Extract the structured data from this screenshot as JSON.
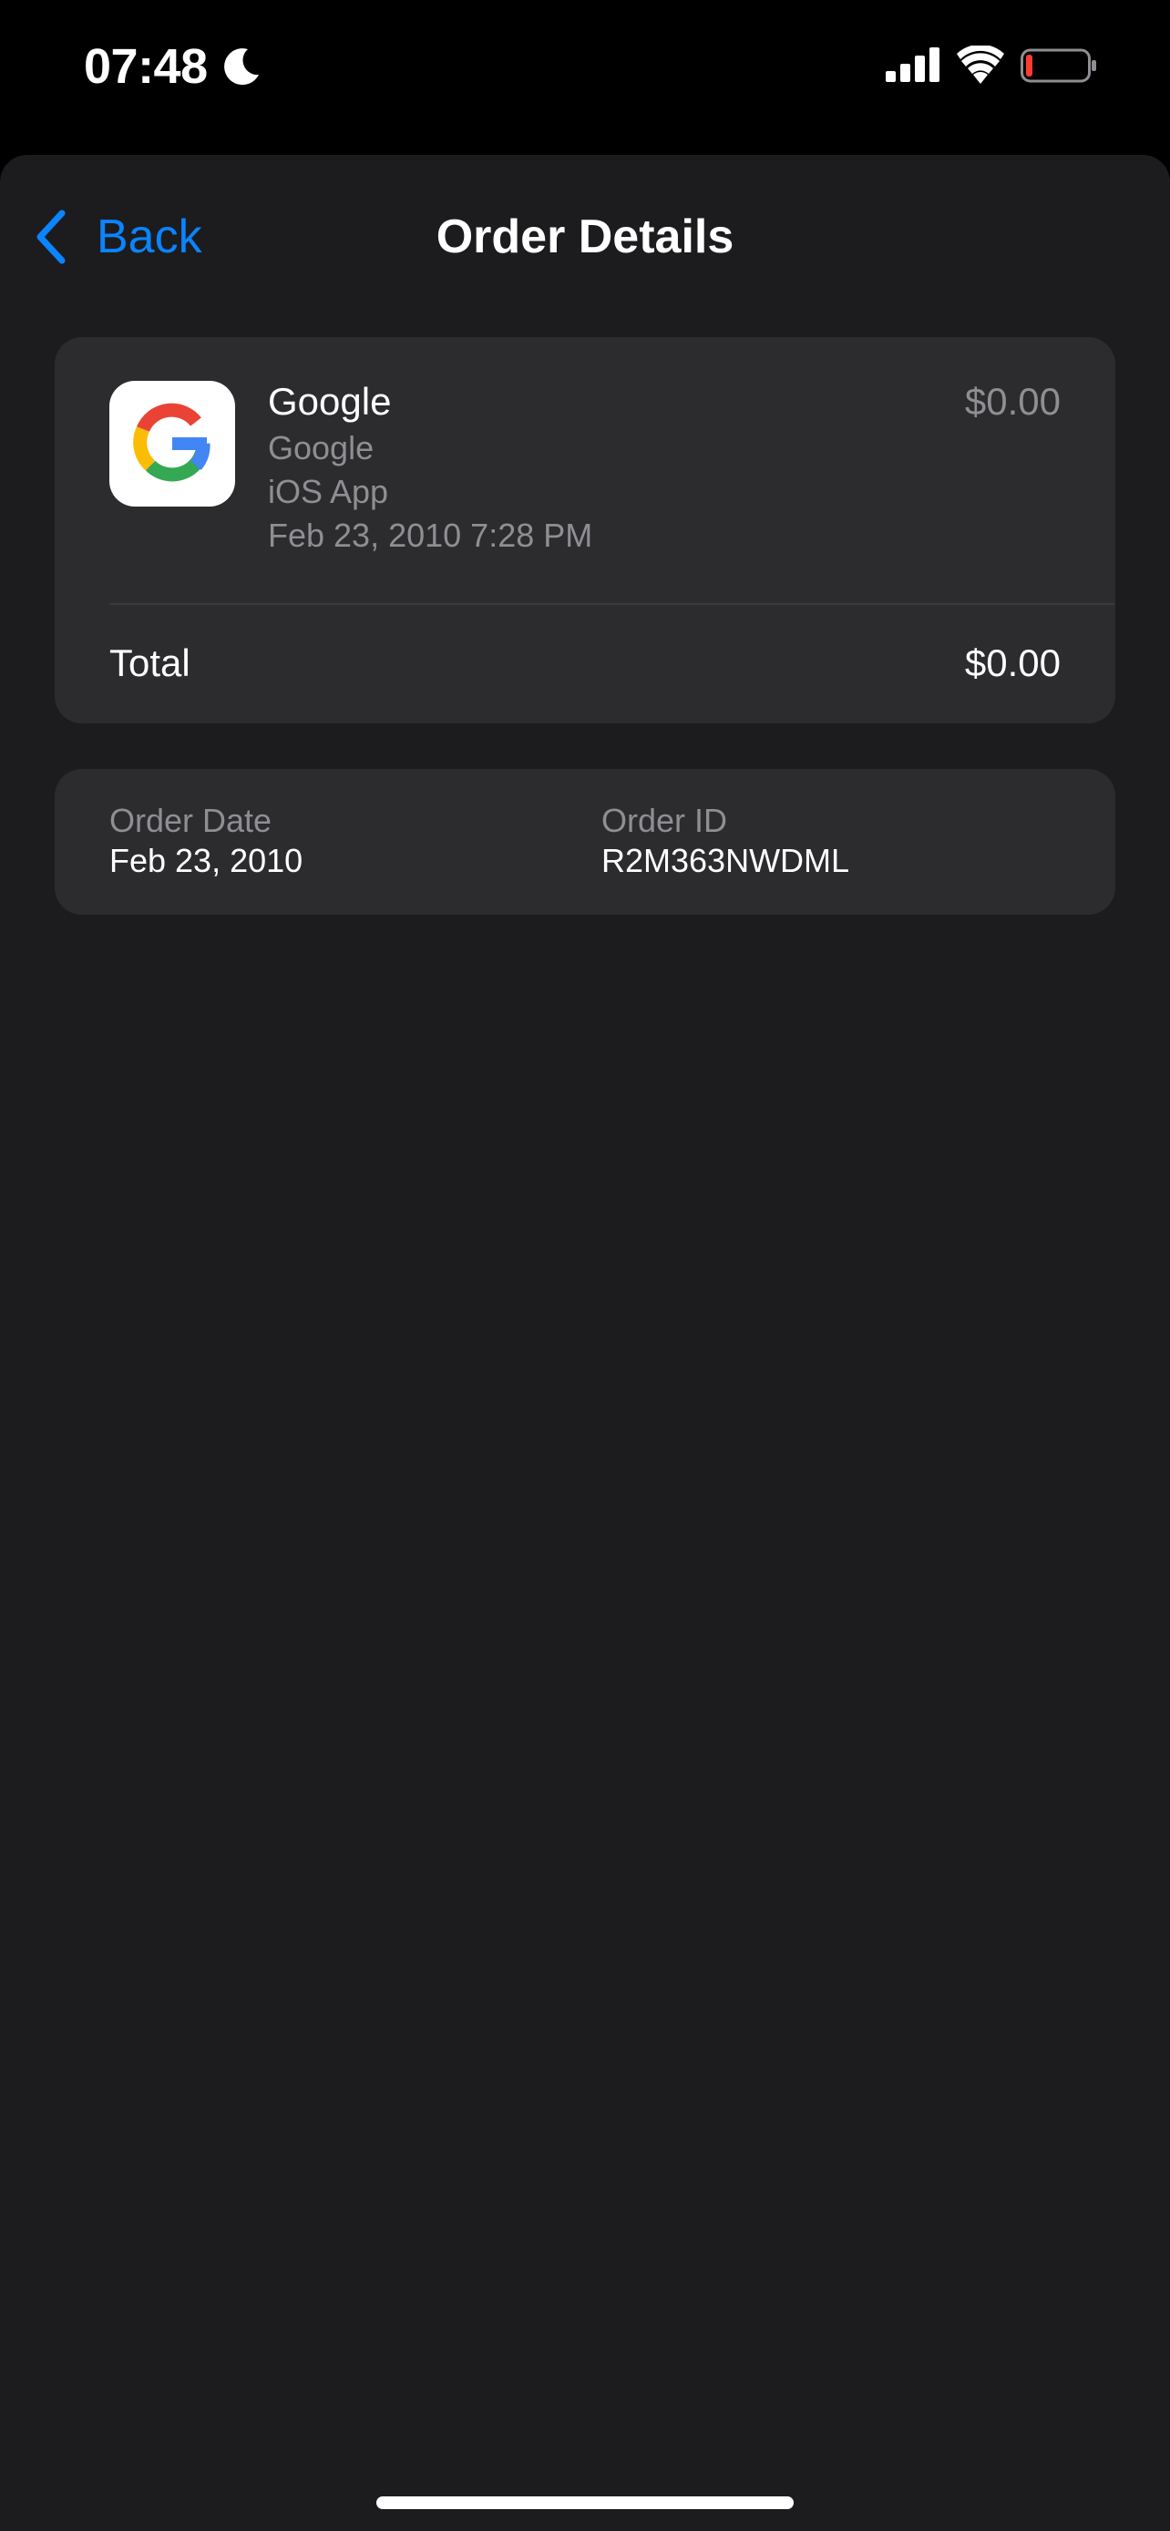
{
  "status_bar": {
    "time": "07:48",
    "focus_icon": "moon-icon",
    "signal_icon": "cellular-signal-icon",
    "wifi_icon": "wifi-icon",
    "battery_icon": "battery-low-icon",
    "battery_level": 0.1,
    "battery_color": "#ff3b30"
  },
  "nav": {
    "back_label": "Back",
    "title": "Order Details"
  },
  "purchase": {
    "app_icon": "google-g-icon",
    "name": "Google",
    "developer": "Google",
    "type": "iOS App",
    "date": "Feb 23, 2010 7:28 PM",
    "price": "$0.00",
    "total_label": "Total",
    "total_value": "$0.00"
  },
  "order_info": {
    "date_label": "Order Date",
    "date_value": "Feb 23, 2010",
    "id_label": "Order ID",
    "id_value": "R2M363NWDML"
  },
  "colors": {
    "background": "#000000",
    "sheet": "#1c1c1e",
    "card": "#2c2c2e",
    "accent": "#0a84ff",
    "secondary_text": "#8e8e93"
  }
}
